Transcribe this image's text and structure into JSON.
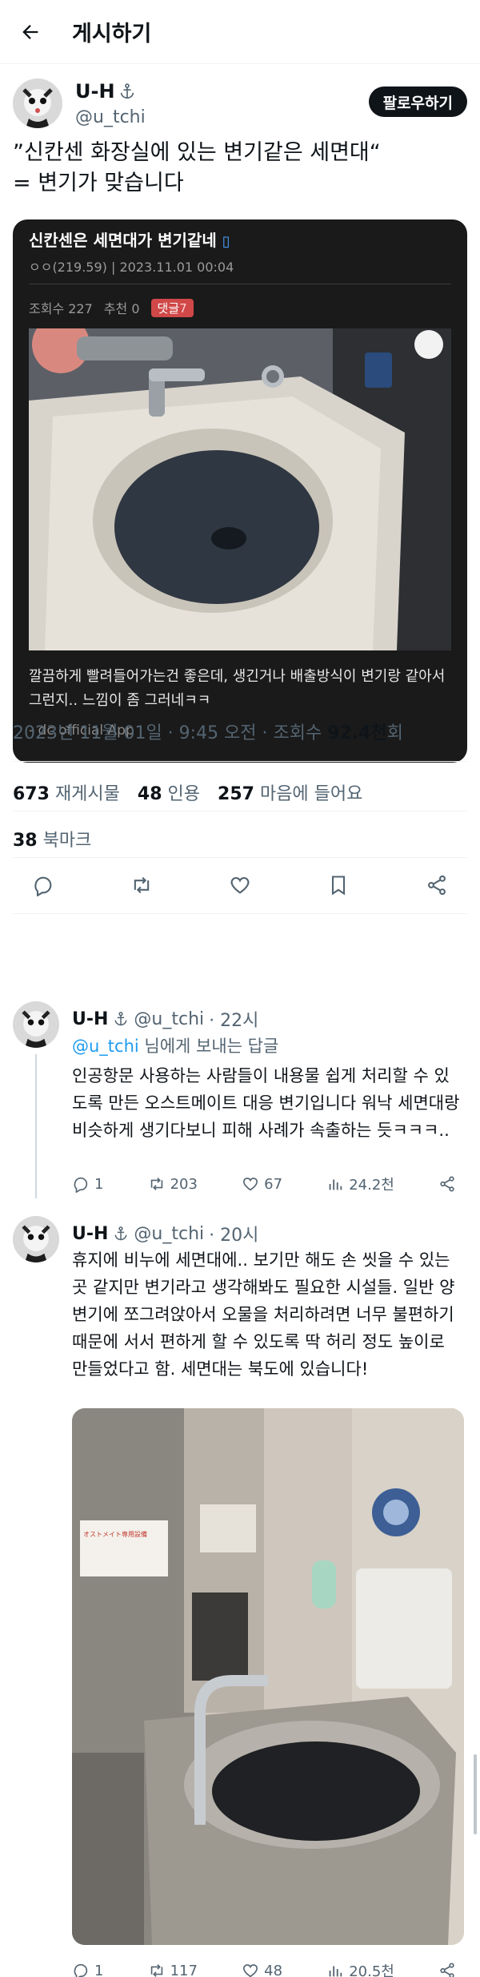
{
  "header": {
    "title": "게시하기"
  },
  "tweet": {
    "author_name": "U-H",
    "author_handle": "@u_tchi",
    "follow_label": "팔로우하기",
    "text": "”신칸센 화장실에 있는 변기같은 세면대“\n= 변기가 맞습니다",
    "timestamp": "2023년 11월 01일 · 9:45 오전 · 조회수 ",
    "views": "92.4천",
    "views_suffix": "회",
    "retweets": "673",
    "retweets_label": "재게시물",
    "quotes": "48",
    "quotes_label": "인용",
    "likes": "257",
    "likes_label": "마음에 들어요",
    "bookmarks": "38",
    "bookmarks_label": "북마크"
  },
  "embed": {
    "title": "신칸센은 세면대가 변기같네",
    "meta": "ㅇㅇ(219.59)  |  2023.11.01 00:04",
    "views": "조회수 227",
    "recommend": "추천 0",
    "replies_label": "댓글",
    "replies_count": "7",
    "caption": "깔끔하게 빨려들어가는건 좋은데, 생긴거나 배출방식이 변기랑 같아서 그런지.. 느낌이 좀 그러네ㅋㅋ",
    "source": "- dc official App"
  },
  "replies": [
    {
      "name": "U-H",
      "handle": "@u_tchi",
      "time": "· 22시",
      "reply_to_mention": "@u_tchi",
      "reply_to_suffix": " 님에게 보내는 답글",
      "text": "인공항문 사용하는 사람들이 내용물 쉽게 처리할 수 있도록 만든 오스트메이트 대응 변기입니다 워낙 세면대랑 비슷하게 생기다보니 피해 사례가 속출하는 듯ㅋㅋㅋ..",
      "replies": "1",
      "retweets": "203",
      "likes": "67",
      "views": "24.2천"
    },
    {
      "name": "U-H",
      "handle": "@u_tchi",
      "time": "· 20시",
      "text": "휴지에 비누에 세면대에.. 보기만 해도 손 씻을 수 있는 곳 같지만 변기라고 생각해봐도 필요한 시설들. 일반 양변기에 쪼그려앉아서 오물을 처리하려면 너무 불편하기 때문에 서서 편하게 할 수 있도록 딱 허리 정도 높이로 만들었다고 함. 세면대는 북도에 있습니다!",
      "sign_text": "オストメイト専用設備",
      "replies": "1",
      "retweets": "117",
      "likes": "48",
      "views": "20.5천"
    }
  ]
}
